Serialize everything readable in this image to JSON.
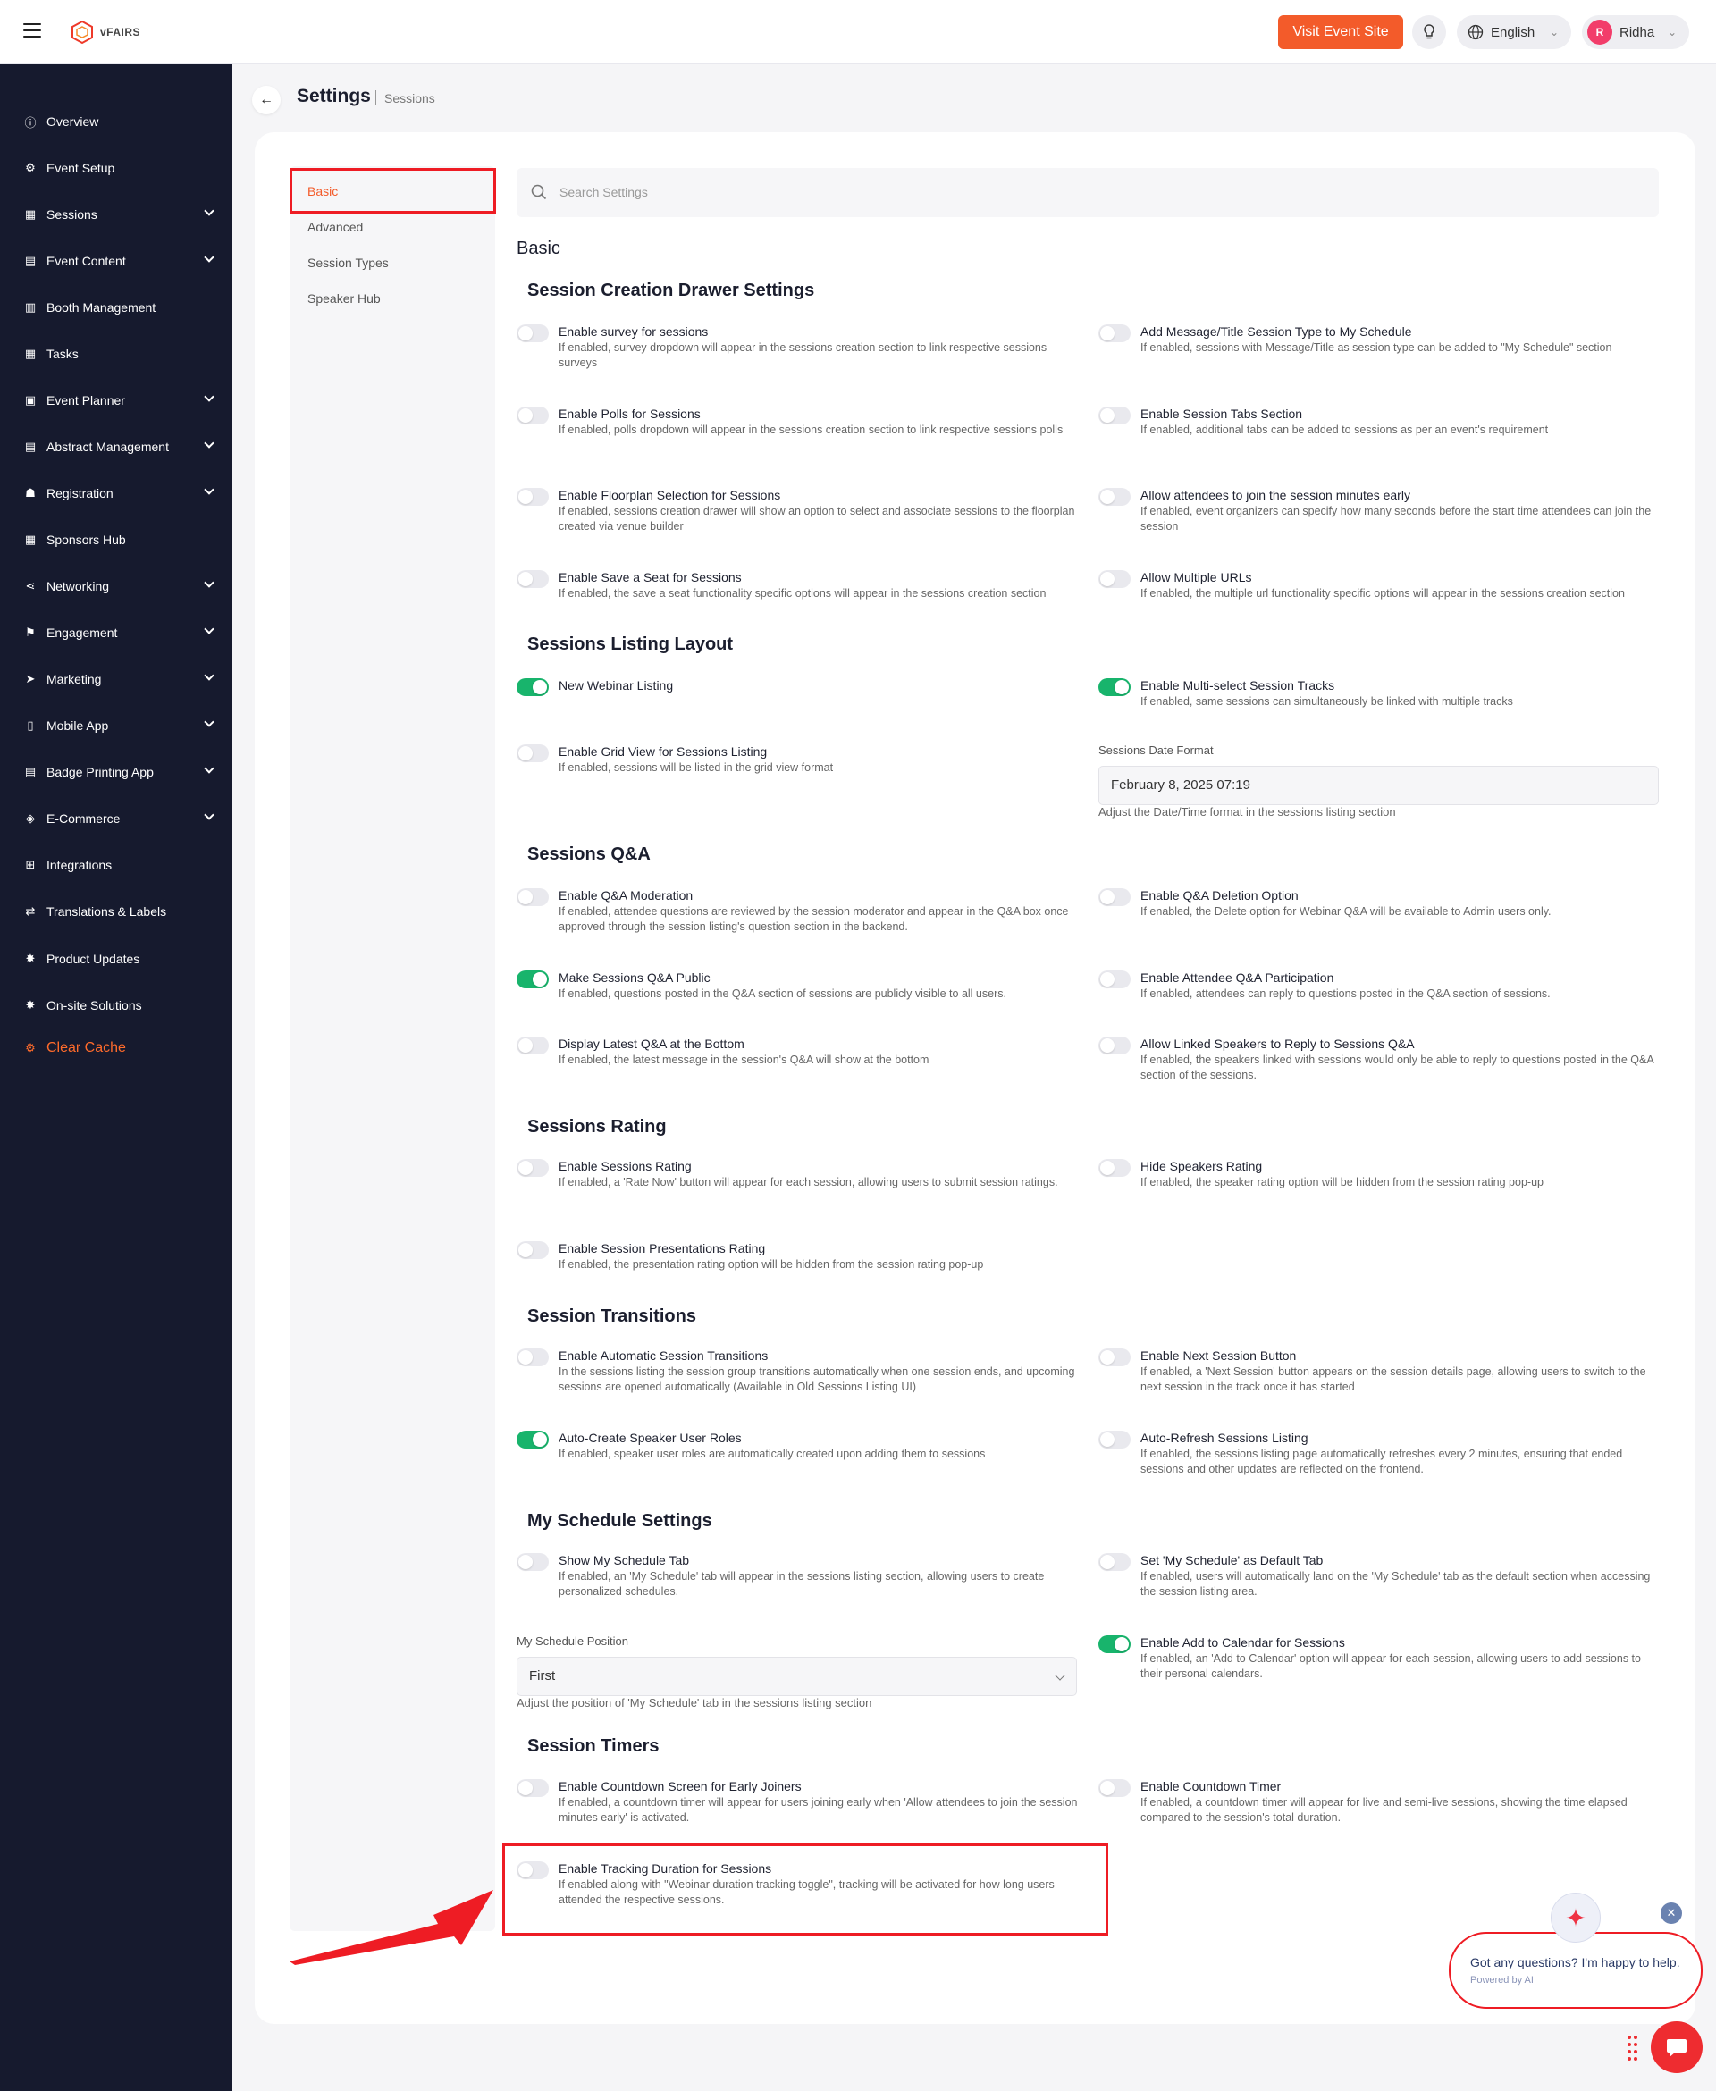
{
  "app": {
    "brand": "vFAIRS",
    "visit_label": "Visit Event Site",
    "language": "English",
    "user_initial": "R",
    "user_name": "Ridha"
  },
  "sidebar": {
    "items": [
      {
        "label": "Overview",
        "icon": "info-icon",
        "chevron": false
      },
      {
        "label": "Event Setup",
        "icon": "gear-icon",
        "chevron": false
      },
      {
        "label": "Sessions",
        "icon": "grid-icon",
        "chevron": true
      },
      {
        "label": "Event Content",
        "icon": "document-icon",
        "chevron": true
      },
      {
        "label": "Booth Management",
        "icon": "booth-icon",
        "chevron": false
      },
      {
        "label": "Tasks",
        "icon": "grid-icon",
        "chevron": false
      },
      {
        "label": "Event Planner",
        "icon": "calendar-icon",
        "chevron": true
      },
      {
        "label": "Abstract Management",
        "icon": "document-icon",
        "chevron": true
      },
      {
        "label": "Registration",
        "icon": "user-add-icon",
        "chevron": true
      },
      {
        "label": "Sponsors Hub",
        "icon": "grid-icon",
        "chevron": false
      },
      {
        "label": "Networking",
        "icon": "share-icon",
        "chevron": true
      },
      {
        "label": "Engagement",
        "icon": "flag-icon",
        "chevron": true
      },
      {
        "label": "Marketing",
        "icon": "send-icon",
        "chevron": true
      },
      {
        "label": "Mobile App",
        "icon": "mobile-icon",
        "chevron": true
      },
      {
        "label": "Badge Printing App",
        "icon": "badge-icon",
        "chevron": true
      },
      {
        "label": "E-Commerce",
        "icon": "cube-icon",
        "chevron": true
      },
      {
        "label": "Integrations",
        "icon": "plus-square-icon",
        "chevron": false
      },
      {
        "label": "Translations & Labels",
        "icon": "translate-icon",
        "chevron": false
      },
      {
        "label": "Product Updates",
        "icon": "megaphone-icon",
        "chevron": false
      },
      {
        "label": "On-site Solutions",
        "icon": "location-icon",
        "chevron": false
      }
    ],
    "clear_cache": "Clear Cache"
  },
  "header": {
    "title": "Settings",
    "breadcrumb": "Sessions"
  },
  "subnav": {
    "items": [
      "Basic",
      "Advanced",
      "Session Types",
      "Speaker Hub"
    ]
  },
  "search": {
    "placeholder": "Search Settings"
  },
  "content": {
    "heading": "Basic",
    "sections": [
      "Session Creation Drawer Settings",
      "Sessions Listing Layout",
      "Sessions Q&A",
      "Sessions Rating",
      "Session Transitions",
      "My Schedule Settings",
      "Session Timers"
    ],
    "settings": [
      {
        "title": "Enable survey for sessions",
        "desc": "If enabled, survey dropdown will appear in the sessions creation section to link respective sessions surveys",
        "on": false
      },
      {
        "title": "Add Message/Title Session Type to My Schedule",
        "desc": "If enabled, sessions with Message/Title as session type can be added to \"My Schedule\" section",
        "on": false
      },
      {
        "title": "Enable Polls for Sessions",
        "desc": "If enabled, polls dropdown will appear in the sessions creation section to link respective sessions polls",
        "on": false
      },
      {
        "title": "Enable Session Tabs Section",
        "desc": "If enabled, additional tabs can be added to sessions as per an event's requirement",
        "on": false
      },
      {
        "title": "Enable Floorplan Selection for Sessions",
        "desc": "If enabled, sessions creation drawer will show an option to select and associate sessions to the floorplan created via venue builder",
        "on": false
      },
      {
        "title": "Allow attendees to join the session minutes early",
        "desc": "If enabled, event organizers can specify how many seconds before the start time attendees can join the session",
        "on": false
      },
      {
        "title": "Enable Save a Seat for Sessions",
        "desc": "If enabled, the save a seat functionality specific options will appear in the sessions creation section",
        "on": false
      },
      {
        "title": "Allow Multiple URLs",
        "desc": "If enabled, the multiple url functionality specific options will appear in the sessions creation section",
        "on": false
      },
      {
        "title": "New Webinar Listing",
        "desc": "",
        "on": true
      },
      {
        "title": "Enable Multi-select Session Tracks",
        "desc": "If enabled, same sessions can simultaneously be linked with multiple tracks",
        "on": true
      },
      {
        "title": "Enable Grid View for Sessions Listing",
        "desc": "If enabled, sessions will be listed in the grid view format",
        "on": false
      },
      {
        "title": "Enable Q&A Moderation",
        "desc": "If enabled, attendee questions are reviewed by the session moderator and appear in the Q&A box once approved through the session listing's question section in the backend.",
        "on": false
      },
      {
        "title": "Enable Q&A Deletion Option",
        "desc": "If enabled, the Delete option for Webinar Q&A will be available to Admin users only.",
        "on": false
      },
      {
        "title": "Make Sessions Q&A Public",
        "desc": "If enabled, questions posted in the Q&A section of sessions are publicly visible to all users.",
        "on": true
      },
      {
        "title": "Enable Attendee Q&A Participation",
        "desc": "If enabled, attendees can reply to questions posted in the Q&A section of sessions.",
        "on": false
      },
      {
        "title": "Display Latest Q&A at the Bottom",
        "desc": "If enabled, the latest message in the session's Q&A will show at the bottom",
        "on": false
      },
      {
        "title": "Allow Linked Speakers to Reply to Sessions Q&A",
        "desc": "If enabled, the speakers linked with sessions would only be able to reply to questions posted in the Q&A section of the sessions.",
        "on": false
      },
      {
        "title": "Enable Sessions Rating",
        "desc": "If enabled, a 'Rate Now' button will appear for each session, allowing users to submit session ratings.",
        "on": false
      },
      {
        "title": "Hide Speakers Rating",
        "desc": "If enabled, the speaker rating option will be hidden from the session rating pop-up",
        "on": false
      },
      {
        "title": "Enable Session Presentations Rating",
        "desc": "If enabled, the presentation rating option will be hidden from the session rating pop-up",
        "on": false
      },
      {
        "title": "Enable Automatic Session Transitions",
        "desc": "In the sessions listing the session group transitions automatically when one session ends, and upcoming sessions are opened automatically (Available in Old Sessions Listing UI)",
        "on": false
      },
      {
        "title": "Enable Next Session Button",
        "desc": "If enabled, a 'Next Session' button appears on the session details page, allowing users to switch to the next session in the track once it has started",
        "on": false
      },
      {
        "title": "Auto-Create Speaker User Roles",
        "desc": "If enabled, speaker user roles are automatically created upon adding them to sessions",
        "on": true
      },
      {
        "title": "Auto-Refresh Sessions Listing",
        "desc": "If enabled, the sessions listing page automatically refreshes every 2 minutes, ensuring that ended sessions and other updates are reflected on the frontend.",
        "on": false
      },
      {
        "title": "Show My Schedule Tab",
        "desc": "If enabled, an 'My Schedule' tab will appear in the sessions listing section, allowing users to create personalized schedules.",
        "on": false
      },
      {
        "title": "Set 'My Schedule' as Default Tab",
        "desc": "If enabled, users will automatically land on the 'My Schedule' tab as the default section when accessing the session listing area.",
        "on": false
      },
      {
        "title": "Enable Add to Calendar for Sessions",
        "desc": "If enabled, an 'Add to Calendar' option will appear for each session, allowing users to add sessions to their personal calendars.",
        "on": true
      },
      {
        "title": "Enable Countdown Screen for Early Joiners",
        "desc": "If enabled, a countdown timer will appear for users joining early when 'Allow attendees to join the session minutes early' is activated.",
        "on": false
      },
      {
        "title": "Enable Countdown Timer",
        "desc": "If enabled, a countdown timer will appear for live and semi-live sessions, showing the time elapsed compared to the session's total duration.",
        "on": false
      },
      {
        "title": "Enable Tracking Duration for Sessions",
        "desc": "If enabled along with \"Webinar duration tracking toggle\", tracking will be activated for how long users attended the respective sessions.",
        "on": false
      }
    ],
    "date_format": {
      "label": "Sessions Date Format",
      "value": "February 8, 2025 07:19",
      "help": "Adjust the Date/Time format in the sessions listing section"
    },
    "schedule_position": {
      "label": "My Schedule Position",
      "value": "First",
      "help": "Adjust the position of 'My Schedule' tab in the sessions listing section"
    }
  },
  "chat": {
    "message": "Got any questions? I'm happy to help.",
    "powered": "Powered by AI"
  },
  "colors": {
    "accent": "#f35b2a",
    "sidebar_bg": "#161a2e",
    "toggle_on": "#18b46c",
    "highlight": "#ee1c24"
  }
}
